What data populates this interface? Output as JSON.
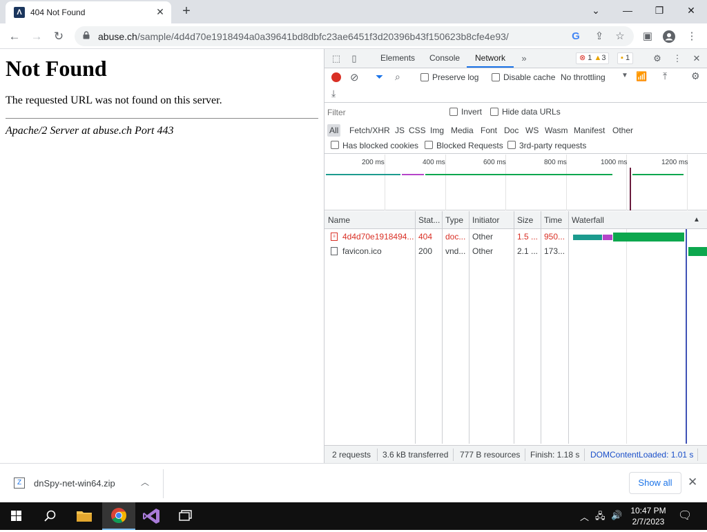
{
  "browser": {
    "tab_title": "404 Not Found",
    "favicon_glyph": "Λ",
    "new_tab": "+",
    "url_host": "abuse.ch",
    "url_path": "/sample/4d4d70e1918494a0a39641bd8dbfc23ae6451f3d20396b43f150623b8cfe4e93/"
  },
  "page": {
    "heading": "Not Found",
    "message": "The requested URL was not found on this server.",
    "server_line": "Apache/2 Server at abuse.ch Port 443"
  },
  "devtools": {
    "tabs": [
      "Elements",
      "Console",
      "Network"
    ],
    "active_tab": "Network",
    "badges": {
      "errors": "1",
      "warnings": "3",
      "issues": "1"
    },
    "toolbar": {
      "preserve_log": "Preserve log",
      "disable_cache": "Disable cache",
      "throttling": "No throttling"
    },
    "filter": {
      "placeholder": "Filter",
      "invert": "Invert",
      "hide_data_urls": "Hide data URLs",
      "types": [
        "All",
        "Fetch/XHR",
        "JS",
        "CSS",
        "Img",
        "Media",
        "Font",
        "Doc",
        "WS",
        "Wasm",
        "Manifest",
        "Other"
      ],
      "active_type": "All",
      "has_blocked_cookies": "Has blocked cookies",
      "blocked_requests": "Blocked Requests",
      "third_party": "3rd-party requests"
    },
    "overview_ticks": [
      "200 ms",
      "400 ms",
      "600 ms",
      "800 ms",
      "1000 ms",
      "1200 ms"
    ],
    "columns": [
      "Name",
      "Stat...",
      "Type",
      "Initiator",
      "Size",
      "Time",
      "Waterfall"
    ],
    "requests": [
      {
        "name": "4d4d70e1918494...",
        "status": "404",
        "type": "doc...",
        "initiator": "Other",
        "size": "1.5 ...",
        "time": "950...",
        "error": true
      },
      {
        "name": "favicon.ico",
        "status": "200",
        "type": "vnd...",
        "initiator": "Other",
        "size": "2.1 ...",
        "time": "173...",
        "error": false
      }
    ],
    "status": {
      "requests": "2 requests",
      "transferred": "3.6 kB transferred",
      "resources": "777 B resources",
      "finish": "Finish: 1.18 s",
      "dcl": "DOMContentLoaded: 1.01 s"
    }
  },
  "download": {
    "file_name": "dnSpy-net-win64.zip",
    "show_all": "Show all"
  },
  "taskbar": {
    "time": "10:47 PM",
    "date": "2/7/2023"
  },
  "colors": {
    "accent": "#1a73e8",
    "error": "#d93025",
    "waterfall_wait": "#1c9b8e",
    "waterfall_ssl": "#b545c9",
    "waterfall_download": "#0da74e",
    "dcl_line": "#3f51b5"
  }
}
